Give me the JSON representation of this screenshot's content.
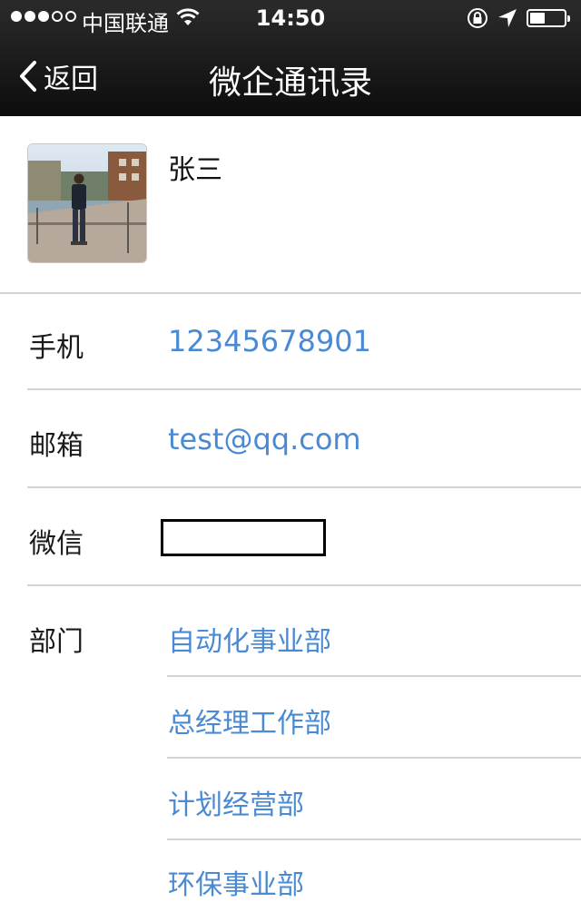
{
  "status_bar": {
    "carrier": "中国联通",
    "time": "14:50",
    "signal_bars_filled": 3,
    "signal_bars_total": 5,
    "battery_level": 0.45
  },
  "nav": {
    "back_label": "返回",
    "title": "微企通讯录"
  },
  "profile": {
    "name": "张三"
  },
  "fields": {
    "phone": {
      "label": "手机",
      "value": "12345678901"
    },
    "email": {
      "label": "邮箱",
      "value": "test@qq.com"
    },
    "wechat": {
      "label": "微信",
      "value": ""
    },
    "department": {
      "label": "部门",
      "items": [
        "自动化事业部",
        "总经理工作部",
        "计划经营部",
        "环保事业部"
      ]
    }
  },
  "colors": {
    "link_blue": "#4a8ad4",
    "navbar_dark": "#1b1b1b",
    "separator": "#d4d4d4"
  }
}
